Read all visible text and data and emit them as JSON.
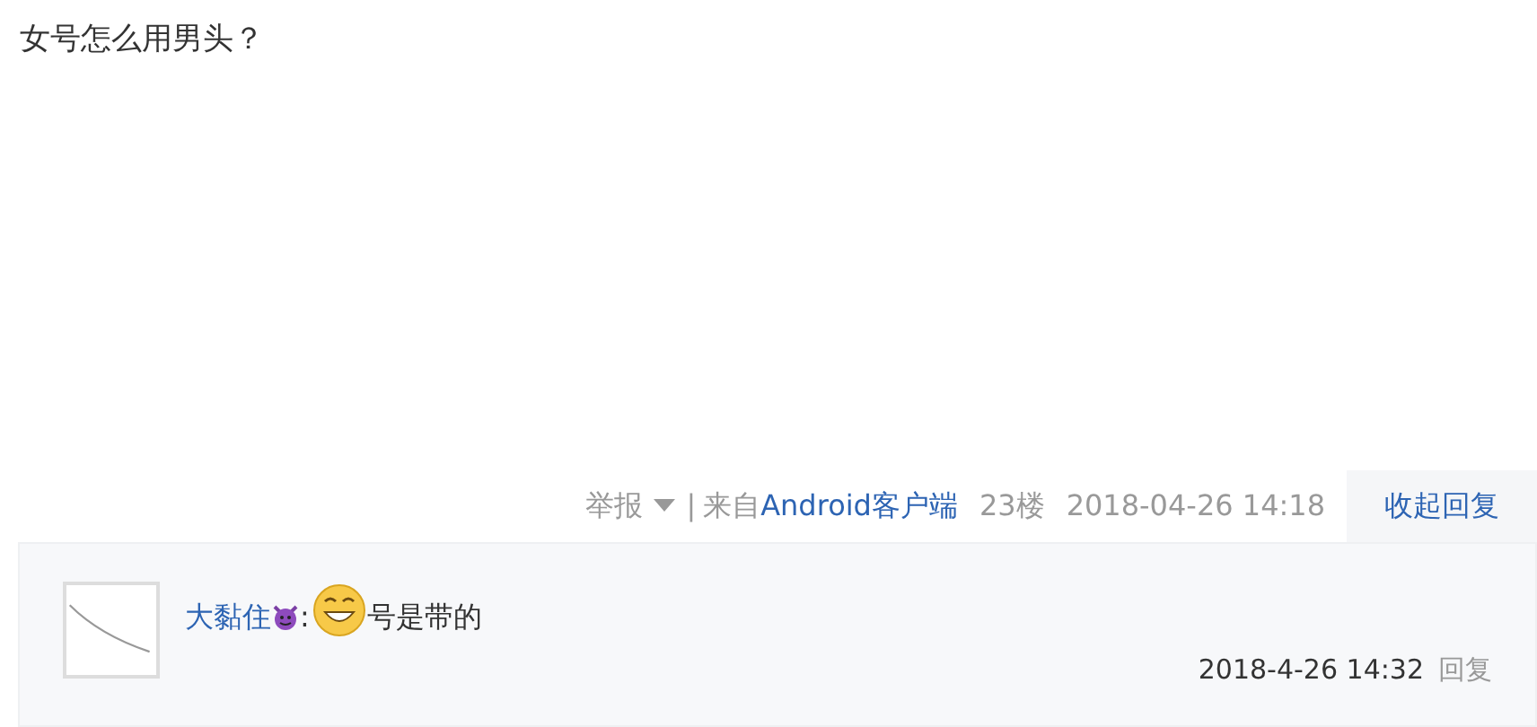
{
  "post": {
    "text": "女号怎么用男头？"
  },
  "footer": {
    "report": "举报",
    "separator": "|",
    "source_prefix": "来自",
    "source_link": "Android客户端",
    "floor": "23楼",
    "time": "2018-04-26 14:18",
    "toggle_replies": "收起回复"
  },
  "replies": [
    {
      "author": "大黏住",
      "colon": ":",
      "text": "号是带的",
      "time": "2018-4-26 14:32",
      "reply_link": "回复"
    }
  ]
}
